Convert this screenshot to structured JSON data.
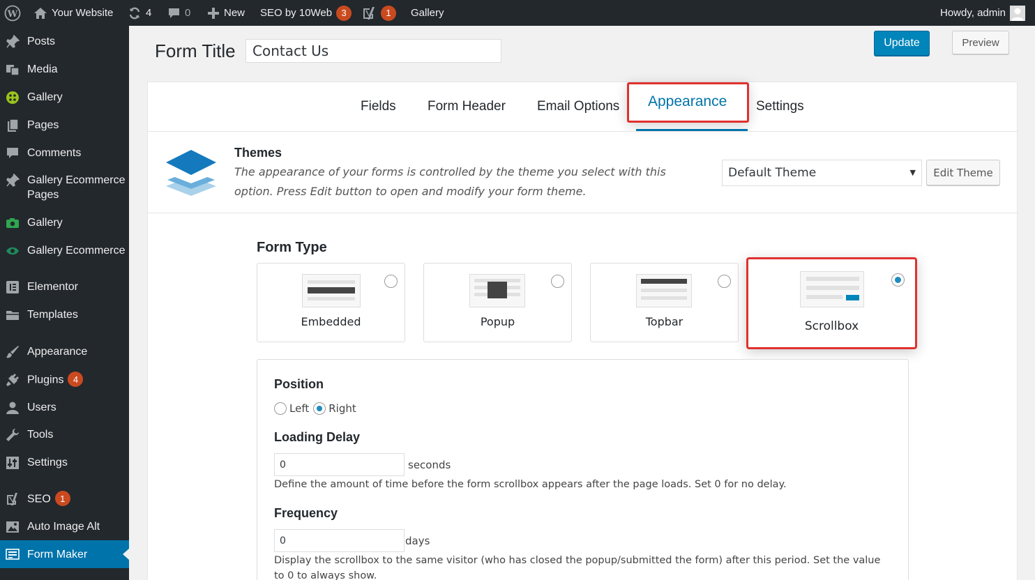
{
  "adminbar": {
    "site_name": "Your Website",
    "updates_count": "4",
    "comments_count": "0",
    "new_label": "New",
    "seo_label": "SEO by 10Web",
    "seo_badge": "3",
    "yoast_badge": "1",
    "gallery_label": "Gallery",
    "howdy": "Howdy, admin"
  },
  "sidebar": {
    "items": [
      {
        "label": "Posts",
        "icon": "pin-icon"
      },
      {
        "label": "Media",
        "icon": "media-icon"
      },
      {
        "label": "Gallery",
        "icon": "gallery-icon"
      },
      {
        "label": "Pages",
        "icon": "pages-icon"
      },
      {
        "label": "Comments",
        "icon": "comment-icon"
      },
      {
        "label": "Gallery Ecommerce Pages",
        "icon": "pin-icon"
      },
      {
        "label": "Gallery",
        "icon": "camera-icon"
      },
      {
        "label": "Gallery Ecommerce",
        "icon": "eye-icon"
      },
      {
        "label": "Elementor",
        "icon": "elementor-icon"
      },
      {
        "label": "Templates",
        "icon": "folder-icon"
      },
      {
        "label": "Appearance",
        "icon": "brush-icon"
      },
      {
        "label": "Plugins",
        "icon": "plug-icon",
        "badge": "4"
      },
      {
        "label": "Users",
        "icon": "user-icon"
      },
      {
        "label": "Tools",
        "icon": "wrench-icon"
      },
      {
        "label": "Settings",
        "icon": "settings-icon"
      },
      {
        "label": "SEO",
        "icon": "yoast-icon",
        "badge": "1"
      },
      {
        "label": "Auto Image Alt",
        "icon": "image-icon"
      },
      {
        "label": "Form Maker",
        "icon": "form-icon"
      }
    ]
  },
  "header": {
    "form_title_label": "Form Title",
    "form_title_value": "Contact Us",
    "update_label": "Update",
    "preview_label": "Preview"
  },
  "tabs": [
    "Fields",
    "Form Header",
    "Email Options",
    "Appearance",
    "Settings"
  ],
  "themes": {
    "title": "Themes",
    "description": "The appearance of your forms is controlled by the theme you select with this option. Press Edit button to open and modify your form theme.",
    "selected_theme": "Default Theme",
    "edit_label": "Edit Theme"
  },
  "form_type": {
    "title": "Form Type",
    "options": [
      "Embedded",
      "Popup",
      "Topbar",
      "Scrollbox"
    ],
    "selected": "Scrollbox"
  },
  "scrollbox_settings": {
    "position_title": "Position",
    "position_left": "Left",
    "position_right": "Right",
    "loading_delay_title": "Loading Delay",
    "loading_delay_value": "0",
    "loading_delay_unit": "seconds",
    "loading_delay_desc": "Define the amount of time before the form scrollbox appears after the page loads. Set 0 for no delay.",
    "frequency_title": "Frequency",
    "frequency_value": "0",
    "frequency_unit": "days",
    "frequency_desc": "Display the scrollbox to the same visitor (who has closed the popup/submitted the form) after this period. Set the value to 0 to always show."
  },
  "colors": {
    "accent": "#0073aa",
    "highlight": "#e0312f",
    "badge": "#ca4a1f",
    "sidebar_bg": "#23282d"
  }
}
